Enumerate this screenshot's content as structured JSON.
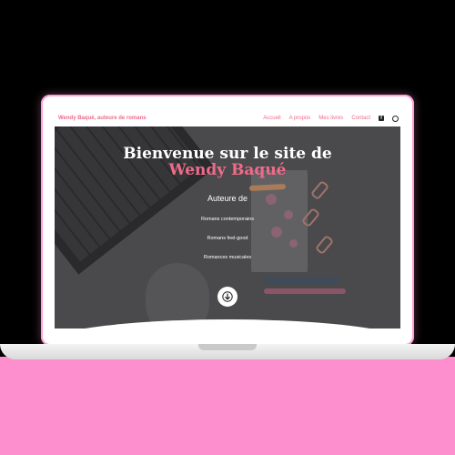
{
  "nav": {
    "brand": "Wendy Baqué, auteure de romans",
    "links": [
      "Accueil",
      "A propos",
      "Mes livres",
      "Contact"
    ]
  },
  "hero": {
    "title": "Bienvenue sur le site de",
    "name": "Wendy Baqué",
    "subtitle": "Auteure de",
    "genres": [
      "Romans contemporains",
      "Romans feel-good",
      "Romances musicales"
    ]
  },
  "icons": {
    "facebook": "facebook-icon",
    "instagram": "instagram-icon",
    "scroll": "arrow-down-icon"
  },
  "colors": {
    "accent": "#ef6b8a",
    "background_pink": "#fd8fcf",
    "background_black": "#000000",
    "laptop_frame": "#ffffff"
  }
}
